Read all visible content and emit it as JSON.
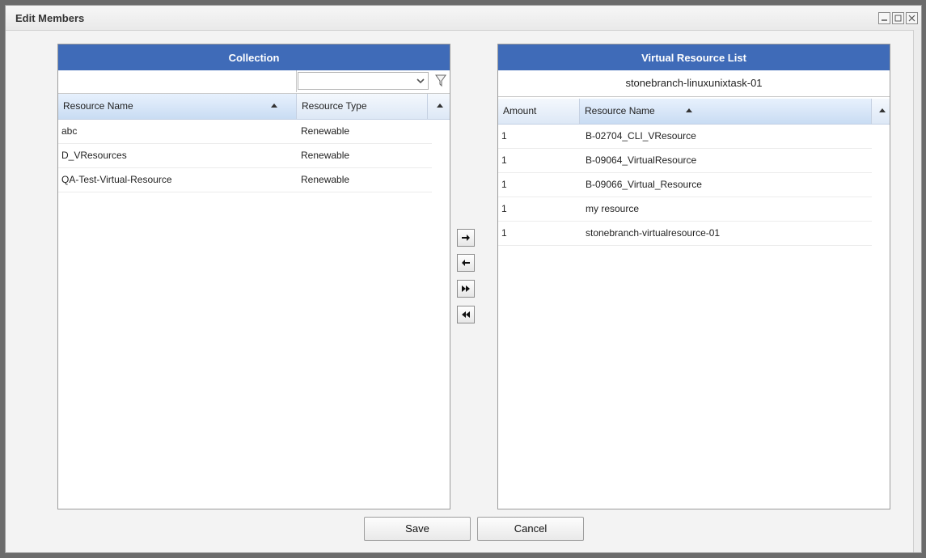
{
  "dialog": {
    "title": "Edit Members"
  },
  "collection": {
    "header": "Collection",
    "filter_text": "",
    "filter_select": "",
    "columns": [
      "Resource Name",
      "Resource Type"
    ],
    "rows": [
      {
        "name": "abc",
        "type": "Renewable"
      },
      {
        "name": "D_VResources",
        "type": "Renewable"
      },
      {
        "name": "QA-Test-Virtual-Resource",
        "type": "Renewable"
      }
    ]
  },
  "transfer": {
    "add_icon": "arrow-right-icon",
    "remove_icon": "arrow-left-icon",
    "add_all_icon": "double-right-icon",
    "remove_all_icon": "double-left-icon"
  },
  "virtual_list": {
    "header": "Virtual Resource List",
    "task_name": "stonebranch-linuxunixtask-01",
    "columns": [
      "Amount",
      "Resource Name"
    ],
    "rows": [
      {
        "amount": "1",
        "name": "B-02704_CLI_VResource"
      },
      {
        "amount": "1",
        "name": "B-09064_VirtualResource"
      },
      {
        "amount": "1",
        "name": "B-09066_Virtual_Resource"
      },
      {
        "amount": "1",
        "name": "my resource"
      },
      {
        "amount": "1",
        "name": "stonebranch-virtualresource-01"
      }
    ]
  },
  "footer": {
    "save_label": "Save",
    "cancel_label": "Cancel"
  },
  "colors": {
    "header_blue": "#3f6bb8",
    "grid_header": "#dde8f6"
  }
}
